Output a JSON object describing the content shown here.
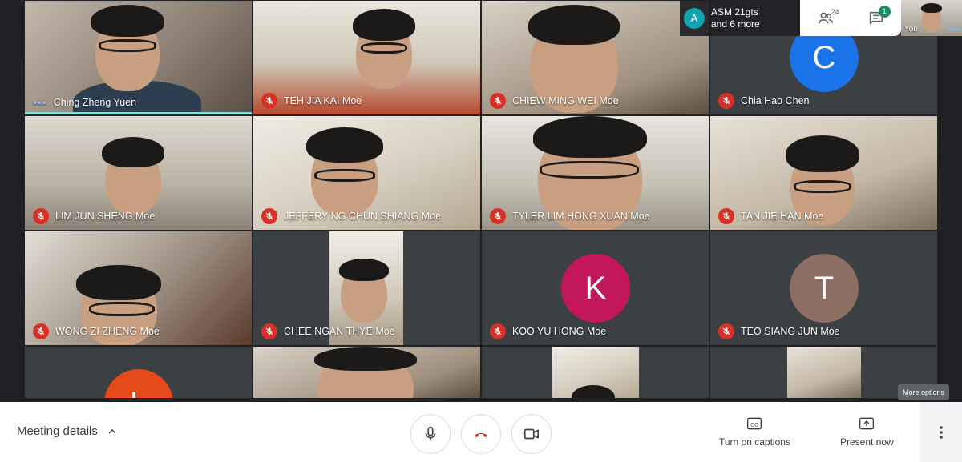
{
  "participants": [
    {
      "name": "Ching Zheng Yuen",
      "speaking": true
    },
    {
      "name": "TEH JIA KAI Moe"
    },
    {
      "name": "CHIEW MING WEI Moe"
    },
    {
      "name": "Chia Hao Chen",
      "avatar_letter": "C",
      "avatar_color": "#1a73e8"
    },
    {
      "name": "LIM JUN SHENG Moe"
    },
    {
      "name": "JEFFERY NG CHUN SHIANG Moe"
    },
    {
      "name": "TYLER LIM HONG XUAN Moe"
    },
    {
      "name": "TAN JIE HAN Moe"
    },
    {
      "name": "WONG ZI ZHENG Moe"
    },
    {
      "name": "CHEE NGAN THYE Moe"
    },
    {
      "name": "KOO YU HONG Moe",
      "avatar_letter": "K",
      "avatar_color": "#c2185b"
    },
    {
      "name": "TEO SIANG JUN Moe",
      "avatar_letter": "T",
      "avatar_color": "#8d6e63"
    },
    {
      "name": "",
      "avatar_letter": "L",
      "avatar_color": "#e64a19"
    }
  ],
  "header": {
    "presenter_avatar_letter": "A",
    "presenter_line1": "ASM 21gts",
    "presenter_line2": "and 6 more",
    "people_count": "24",
    "chat_badge": "1",
    "self_label": "You",
    "self_dots": "•••"
  },
  "speaking_dots": "•••",
  "tooltip": "More options",
  "bottom_bar": {
    "meeting_details": "Meeting details",
    "captions_label": "Turn on captions",
    "captions_icon_text": "CC",
    "present_label": "Present now"
  },
  "colors": {
    "mute_red": "#d93025",
    "end_call_red": "#d93025",
    "active_speaker": "#7ee0d0"
  }
}
